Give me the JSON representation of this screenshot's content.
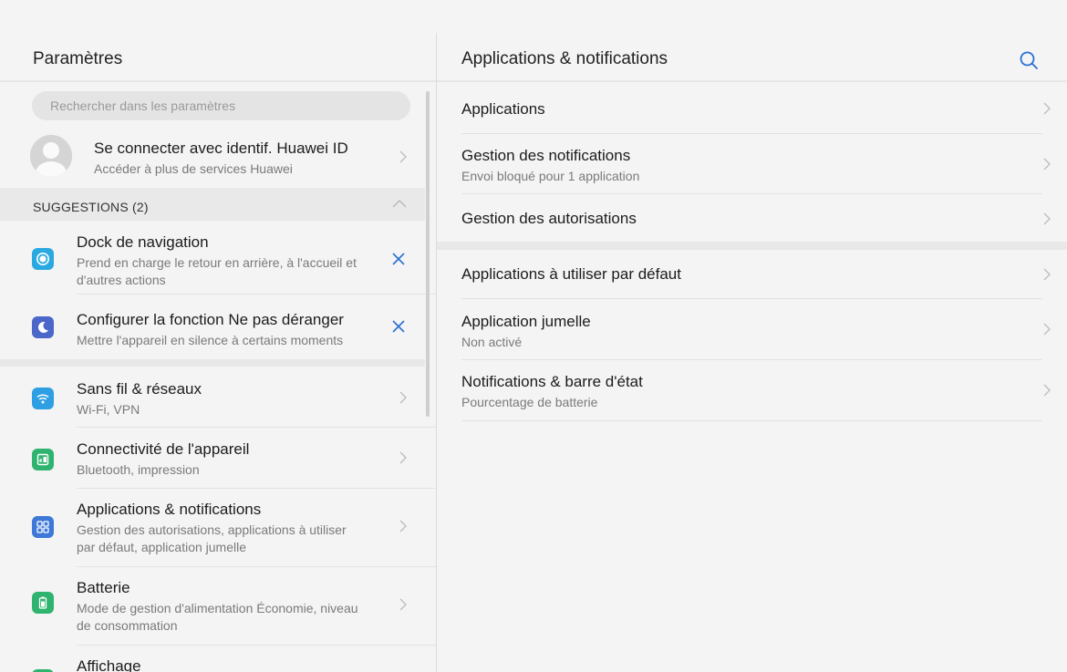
{
  "left": {
    "title": "Paramètres",
    "search_placeholder": "Rechercher dans les paramètres",
    "account": {
      "title": "Se connecter avec identif. Huawei ID",
      "subtitle": "Accéder à plus de services Huawei"
    },
    "suggestions": {
      "label": "SUGGESTIONS (2)",
      "items": [
        {
          "title": "Dock de navigation",
          "subtitle_1": "Prend en charge le retour en arrière, à l'accueil et",
          "subtitle_2": "d'autres actions",
          "icon": "navigation-dock-icon",
          "color": "#2aa9e0"
        },
        {
          "title": "Configurer la fonction Ne pas déranger",
          "subtitle_1": "Mettre l'appareil en silence à certains moments",
          "icon": "moon-icon",
          "color": "#4a67c9"
        }
      ]
    },
    "items": [
      {
        "title": "Sans fil & réseaux",
        "subtitle_1": "Wi-Fi, VPN",
        "icon": "wifi-icon",
        "color": "#2e9fe3"
      },
      {
        "title": "Connectivité de l'appareil",
        "subtitle_1": "Bluetooth, impression",
        "icon": "device-connectivity-icon",
        "color": "#2fb46f"
      },
      {
        "title": "Applications & notifications",
        "subtitle_1": "Gestion des autorisations, applications à utiliser",
        "subtitle_2": "par défaut, application jumelle",
        "icon": "apps-grid-icon",
        "color": "#3e78d8"
      },
      {
        "title": "Batterie",
        "subtitle_1": "Mode de gestion d'alimentation Économie, niveau",
        "subtitle_2": "de consommation",
        "icon": "battery-icon",
        "color": "#2fb46f"
      },
      {
        "title": "Affichage",
        "icon": "display-icon",
        "color": "#2fb46f"
      }
    ]
  },
  "right": {
    "title": "Applications & notifications",
    "items": [
      {
        "title": "Applications"
      },
      {
        "title": "Gestion des notifications",
        "subtitle": "Envoi bloqué pour 1 application"
      },
      {
        "title": "Gestion des autorisations"
      },
      {
        "title": "Applications à utiliser par défaut"
      },
      {
        "title": "Application jumelle",
        "subtitle": "Non activé"
      },
      {
        "title": "Notifications & barre d'état",
        "subtitle": "Pourcentage de batterie"
      }
    ]
  },
  "colors": {
    "accent": "#2a6fd6",
    "background": "#f4f4f4"
  }
}
